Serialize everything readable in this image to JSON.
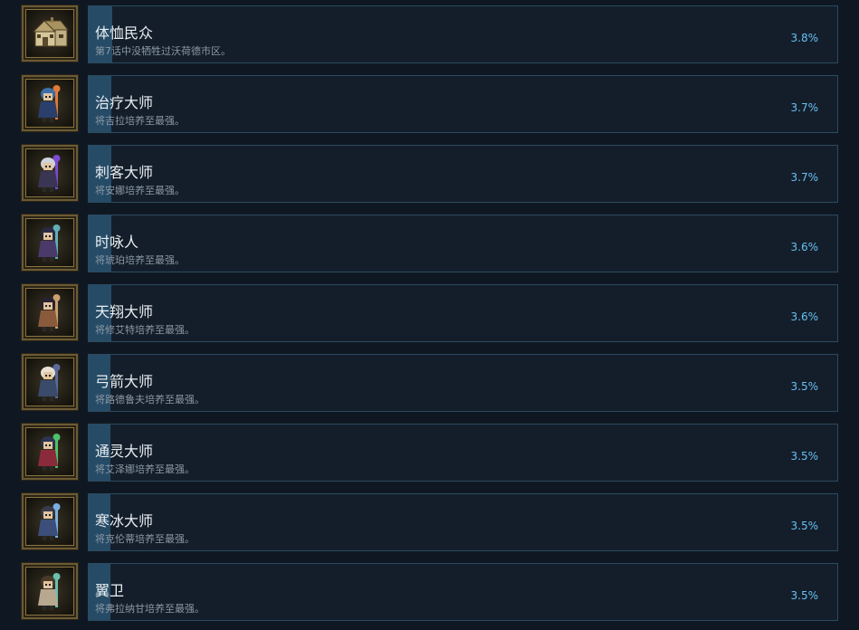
{
  "achievements": [
    {
      "title": "体恤民众",
      "description": "第7话中没牺牲过沃荷德市区。",
      "percent": "3.8%",
      "percent_value": 3.8,
      "icon": "house-icon"
    },
    {
      "title": "治疗大师",
      "description": "将吉拉培养至最强。",
      "percent": "3.7%",
      "percent_value": 3.7,
      "icon": "healer-character-icon"
    },
    {
      "title": "刺客大师",
      "description": "将安娜培养至最强。",
      "percent": "3.7%",
      "percent_value": 3.7,
      "icon": "assassin-character-icon"
    },
    {
      "title": "时咏人",
      "description": "将琥珀培养至最强。",
      "percent": "3.6%",
      "percent_value": 3.6,
      "icon": "timemage-character-icon"
    },
    {
      "title": "天翔大师",
      "description": "将修艾特培养至最强。",
      "percent": "3.6%",
      "percent_value": 3.6,
      "icon": "skyrider-character-icon"
    },
    {
      "title": "弓箭大师",
      "description": "将路德鲁夫培养至最强。",
      "percent": "3.5%",
      "percent_value": 3.5,
      "icon": "archer-character-icon"
    },
    {
      "title": "通灵大师",
      "description": "将艾泽娜培养至最强。",
      "percent": "3.5%",
      "percent_value": 3.5,
      "icon": "spiritmaster-character-icon"
    },
    {
      "title": "寒冰大师",
      "description": "将克伦蒂培养至最强。",
      "percent": "3.5%",
      "percent_value": 3.5,
      "icon": "icemage-character-icon"
    },
    {
      "title": "翼卫",
      "description": "将弗拉纳甘培养至最强。",
      "percent": "3.5%",
      "percent_value": 3.5,
      "icon": "wingguard-character-icon"
    }
  ],
  "colors": {
    "background": "#0f1822",
    "card_border": "#2c4a60",
    "progress_fill": "#264b66",
    "percent_text": "#66c0f4"
  }
}
